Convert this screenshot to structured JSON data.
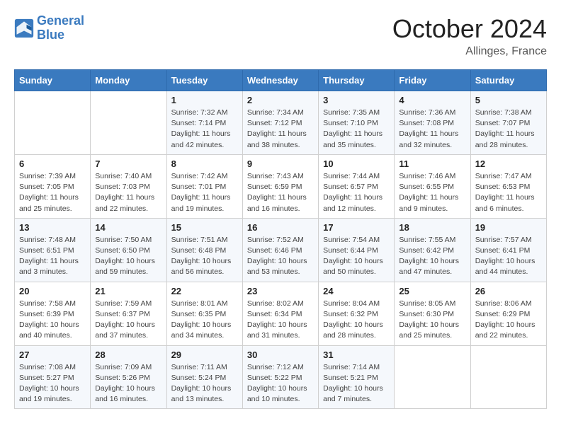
{
  "header": {
    "logo_line1": "General",
    "logo_line2": "Blue",
    "month": "October 2024",
    "location": "Allinges, France"
  },
  "days_of_week": [
    "Sunday",
    "Monday",
    "Tuesday",
    "Wednesday",
    "Thursday",
    "Friday",
    "Saturday"
  ],
  "weeks": [
    [
      {
        "day": "",
        "info": ""
      },
      {
        "day": "",
        "info": ""
      },
      {
        "day": "1",
        "info": "Sunrise: 7:32 AM\nSunset: 7:14 PM\nDaylight: 11 hours and 42 minutes."
      },
      {
        "day": "2",
        "info": "Sunrise: 7:34 AM\nSunset: 7:12 PM\nDaylight: 11 hours and 38 minutes."
      },
      {
        "day": "3",
        "info": "Sunrise: 7:35 AM\nSunset: 7:10 PM\nDaylight: 11 hours and 35 minutes."
      },
      {
        "day": "4",
        "info": "Sunrise: 7:36 AM\nSunset: 7:08 PM\nDaylight: 11 hours and 32 minutes."
      },
      {
        "day": "5",
        "info": "Sunrise: 7:38 AM\nSunset: 7:07 PM\nDaylight: 11 hours and 28 minutes."
      }
    ],
    [
      {
        "day": "6",
        "info": "Sunrise: 7:39 AM\nSunset: 7:05 PM\nDaylight: 11 hours and 25 minutes."
      },
      {
        "day": "7",
        "info": "Sunrise: 7:40 AM\nSunset: 7:03 PM\nDaylight: 11 hours and 22 minutes."
      },
      {
        "day": "8",
        "info": "Sunrise: 7:42 AM\nSunset: 7:01 PM\nDaylight: 11 hours and 19 minutes."
      },
      {
        "day": "9",
        "info": "Sunrise: 7:43 AM\nSunset: 6:59 PM\nDaylight: 11 hours and 16 minutes."
      },
      {
        "day": "10",
        "info": "Sunrise: 7:44 AM\nSunset: 6:57 PM\nDaylight: 11 hours and 12 minutes."
      },
      {
        "day": "11",
        "info": "Sunrise: 7:46 AM\nSunset: 6:55 PM\nDaylight: 11 hours and 9 minutes."
      },
      {
        "day": "12",
        "info": "Sunrise: 7:47 AM\nSunset: 6:53 PM\nDaylight: 11 hours and 6 minutes."
      }
    ],
    [
      {
        "day": "13",
        "info": "Sunrise: 7:48 AM\nSunset: 6:51 PM\nDaylight: 11 hours and 3 minutes."
      },
      {
        "day": "14",
        "info": "Sunrise: 7:50 AM\nSunset: 6:50 PM\nDaylight: 10 hours and 59 minutes."
      },
      {
        "day": "15",
        "info": "Sunrise: 7:51 AM\nSunset: 6:48 PM\nDaylight: 10 hours and 56 minutes."
      },
      {
        "day": "16",
        "info": "Sunrise: 7:52 AM\nSunset: 6:46 PM\nDaylight: 10 hours and 53 minutes."
      },
      {
        "day": "17",
        "info": "Sunrise: 7:54 AM\nSunset: 6:44 PM\nDaylight: 10 hours and 50 minutes."
      },
      {
        "day": "18",
        "info": "Sunrise: 7:55 AM\nSunset: 6:42 PM\nDaylight: 10 hours and 47 minutes."
      },
      {
        "day": "19",
        "info": "Sunrise: 7:57 AM\nSunset: 6:41 PM\nDaylight: 10 hours and 44 minutes."
      }
    ],
    [
      {
        "day": "20",
        "info": "Sunrise: 7:58 AM\nSunset: 6:39 PM\nDaylight: 10 hours and 40 minutes."
      },
      {
        "day": "21",
        "info": "Sunrise: 7:59 AM\nSunset: 6:37 PM\nDaylight: 10 hours and 37 minutes."
      },
      {
        "day": "22",
        "info": "Sunrise: 8:01 AM\nSunset: 6:35 PM\nDaylight: 10 hours and 34 minutes."
      },
      {
        "day": "23",
        "info": "Sunrise: 8:02 AM\nSunset: 6:34 PM\nDaylight: 10 hours and 31 minutes."
      },
      {
        "day": "24",
        "info": "Sunrise: 8:04 AM\nSunset: 6:32 PM\nDaylight: 10 hours and 28 minutes."
      },
      {
        "day": "25",
        "info": "Sunrise: 8:05 AM\nSunset: 6:30 PM\nDaylight: 10 hours and 25 minutes."
      },
      {
        "day": "26",
        "info": "Sunrise: 8:06 AM\nSunset: 6:29 PM\nDaylight: 10 hours and 22 minutes."
      }
    ],
    [
      {
        "day": "27",
        "info": "Sunrise: 7:08 AM\nSunset: 5:27 PM\nDaylight: 10 hours and 19 minutes."
      },
      {
        "day": "28",
        "info": "Sunrise: 7:09 AM\nSunset: 5:26 PM\nDaylight: 10 hours and 16 minutes."
      },
      {
        "day": "29",
        "info": "Sunrise: 7:11 AM\nSunset: 5:24 PM\nDaylight: 10 hours and 13 minutes."
      },
      {
        "day": "30",
        "info": "Sunrise: 7:12 AM\nSunset: 5:22 PM\nDaylight: 10 hours and 10 minutes."
      },
      {
        "day": "31",
        "info": "Sunrise: 7:14 AM\nSunset: 5:21 PM\nDaylight: 10 hours and 7 minutes."
      },
      {
        "day": "",
        "info": ""
      },
      {
        "day": "",
        "info": ""
      }
    ]
  ]
}
